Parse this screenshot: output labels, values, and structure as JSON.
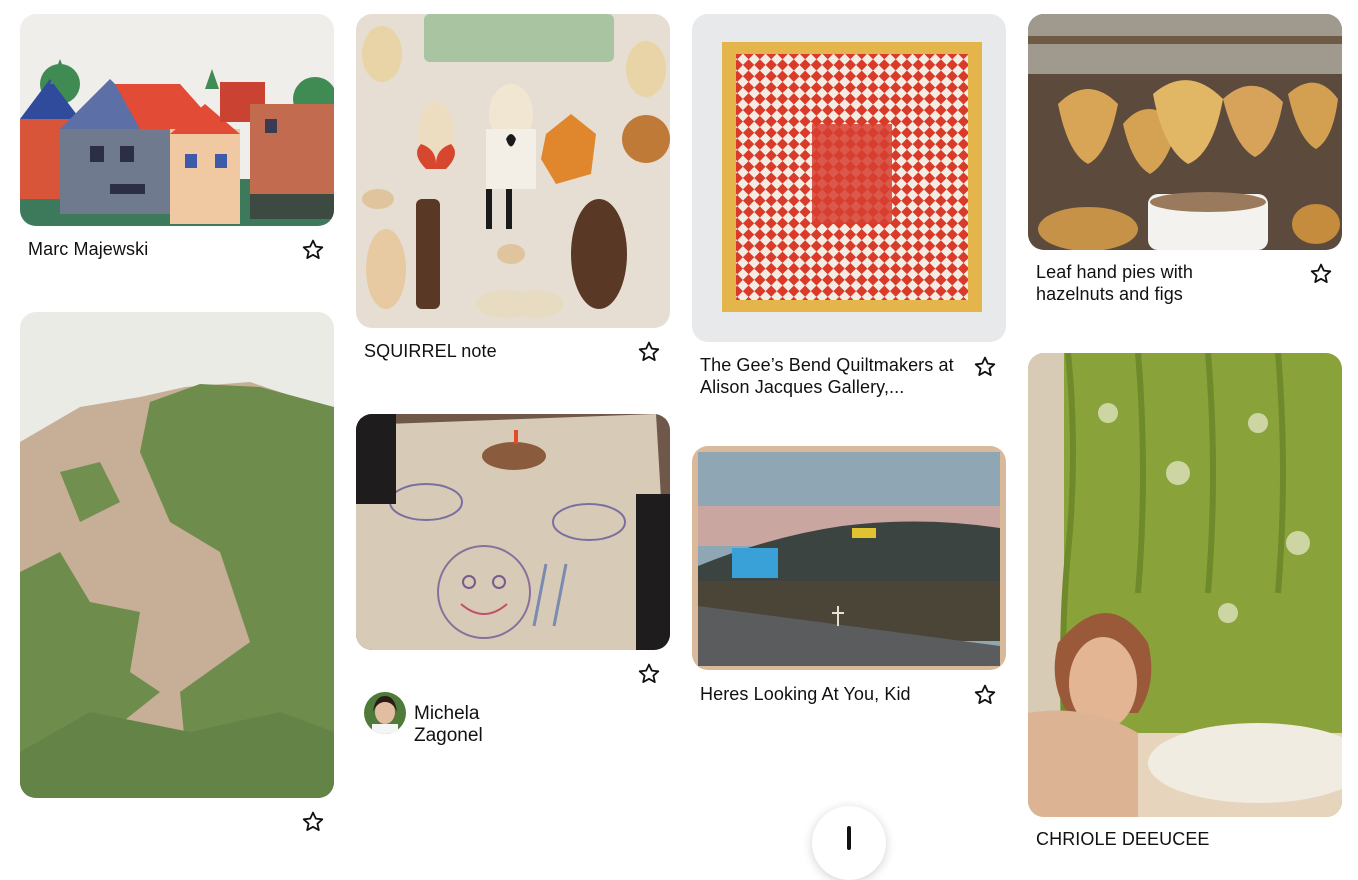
{
  "pins": [
    {
      "id": "pin-1",
      "title": "Marc Majewski"
    },
    {
      "id": "pin-2",
      "title": "SQUIRREL note"
    },
    {
      "id": "pin-3",
      "title": "The Gee’s Bend Quiltmakers at Alison Jacques Gallery,..."
    },
    {
      "id": "pin-4",
      "title": "Leaf hand pies with hazelnuts and figs"
    },
    {
      "id": "pin-5",
      "title": ""
    },
    {
      "id": "pin-6",
      "author": "Michela Zagonel"
    },
    {
      "id": "pin-7",
      "title": "Heres Looking At You, Kid"
    },
    {
      "id": "pin-8",
      "title": "CHRIOLE DEEUCEE"
    }
  ],
  "icons": {
    "save": "star-outline-icon",
    "create": "plus-icon"
  }
}
